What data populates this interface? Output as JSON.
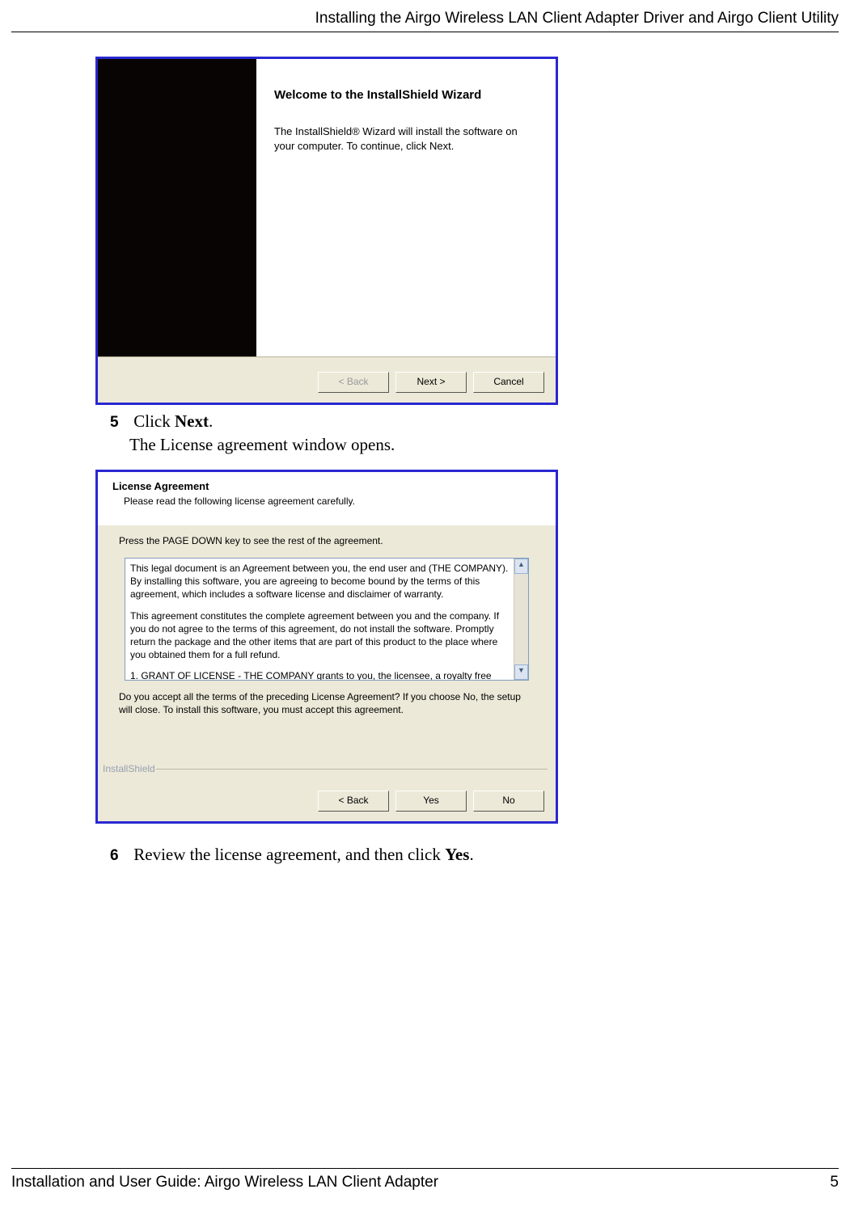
{
  "header": {
    "title": "Installing the Airgo Wireless LAN Client Adapter Driver and Airgo Client Utility"
  },
  "wizard1": {
    "title": "Welcome to the InstallShield Wizard",
    "body": "The InstallShield® Wizard will install the software on your computer.  To continue, click Next.",
    "back": "< Back",
    "next": "Next >",
    "cancel": "Cancel"
  },
  "step5": {
    "num": "5",
    "text_a": "Click ",
    "text_b": "Next",
    "text_c": ".",
    "sub": "The License agreement window opens."
  },
  "license": {
    "banner_title": "License Agreement",
    "banner_sub": "Please read the following license agreement carefully.",
    "hint": "Press the PAGE DOWN key to see the rest of the agreement.",
    "p1": "This legal document is an Agreement between you, the end user and (THE COMPANY). By installing this software, you are agreeing to become bound by the terms of this agreement, which includes a software license and disclaimer of warranty.",
    "p2": "This agreement constitutes the complete agreement between you and the company. If you do not agree to the terms of this agreement, do not install the software. Promptly return the package and the other items that are part of this product to the place where you obtained them for a full refund.",
    "p3": "1.    GRANT OF LICENSE - THE COMPANY grants to you, the licensee, a royalty free",
    "accept": "Do you accept all the terms of the preceding License Agreement?  If you choose No,  the setup will close.  To install this software, you must accept this agreement.",
    "brand": "InstallShield",
    "back": "< Back",
    "yes": "Yes",
    "no": "No"
  },
  "step6": {
    "num": "6",
    "text_a": "Review the license agreement, and then click ",
    "text_b": "Yes",
    "text_c": "."
  },
  "footer": {
    "left": "Installation and User Guide: Airgo Wireless LAN Client Adapter",
    "right": "5"
  }
}
